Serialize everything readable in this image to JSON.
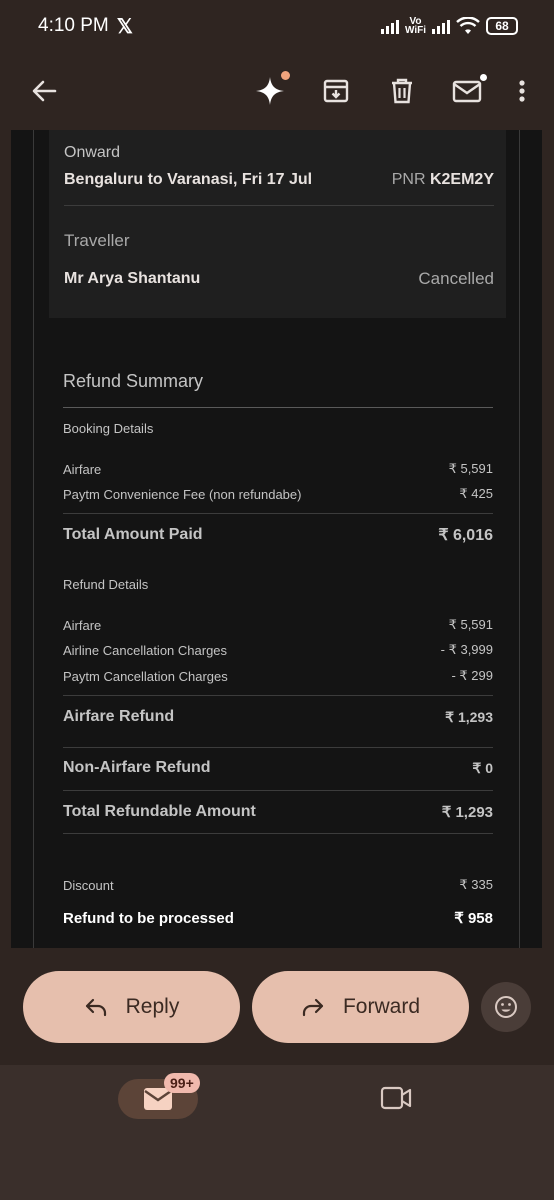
{
  "status": {
    "time": "4:10 PM",
    "x_mark": "𝕏",
    "vowifi_top": "Vo",
    "vowifi_bottom": "WiFi",
    "battery": "68"
  },
  "appbar": {
    "back_icon": "back-arrow-icon",
    "icons": [
      "sparkle-icon",
      "archive-icon",
      "delete-icon",
      "mark-unread-icon",
      "more-vert-icon"
    ]
  },
  "trip": {
    "onward_label": "Onward",
    "route": "Bengaluru to Varanasi, Fri 17 Jul",
    "pnr_label": "PNR",
    "pnr": "K2EM2Y",
    "traveller_label": "Traveller",
    "traveller_name": "Mr Arya Shantanu",
    "traveller_status": "Cancelled"
  },
  "refund": {
    "title": "Refund Summary",
    "booking_details_label": "Booking Details",
    "booking": [
      {
        "label": "Airfare",
        "value": "₹ 5,591"
      },
      {
        "label": "Paytm Convenience Fee (non refundabe)",
        "value": "₹ 425"
      }
    ],
    "total_paid": {
      "label": "Total Amount Paid",
      "value": "₹ 6,016"
    },
    "refund_details_label": "Refund Details",
    "refund_rows": [
      {
        "label": "Airfare",
        "value": "₹ 5,591"
      },
      {
        "label": "Airline Cancellation Charges",
        "value": "- ₹ 3,999"
      },
      {
        "label": "Paytm Cancellation Charges",
        "value": "- ₹ 299"
      }
    ],
    "airfare_refund": {
      "label": "Airfare Refund",
      "value": "₹ 1,293"
    },
    "non_airfare_refund": {
      "label": "Non-Airfare Refund",
      "value": "₹ 0"
    },
    "total_refundable": {
      "label": "Total Refundable Amount",
      "value": "₹ 1,293"
    },
    "discount": {
      "label": "Discount",
      "value": "₹ 335"
    },
    "to_process": {
      "label": "Refund to be processed",
      "value": "₹ 958"
    }
  },
  "actions": {
    "reply": "Reply",
    "forward": "Forward"
  },
  "bottomnav": {
    "mail_badge": "99+"
  },
  "colors": {
    "accent_pill": "#e6bfad",
    "background": "#2f2521",
    "email_bg": "#141414"
  }
}
